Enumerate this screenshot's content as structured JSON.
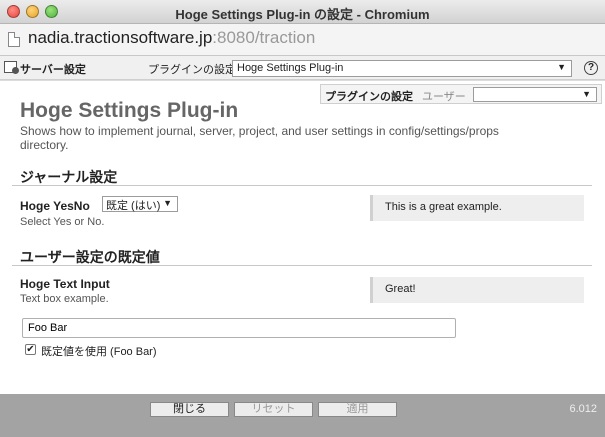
{
  "window": {
    "title": "Hoge Settings Plug-in の設定 - Chromium"
  },
  "address": {
    "host": "nadia.tractionsoftware.jp",
    "path": ":8080/traction"
  },
  "toolbar": {
    "server_label": "サーバー設定",
    "plugin_label": "プラグインの設定",
    "plugin_select_value": "Hoge Settings Plug-in",
    "help_icon": "?"
  },
  "tabs": {
    "plugin_tab": "プラグインの設定",
    "user_label": "ユーザー",
    "user_select_value": ""
  },
  "plugin": {
    "title": "Hoge Settings Plug-in",
    "description": "Shows how to implement journal, server, project, and user settings in config/settings/props directory."
  },
  "journal_section": {
    "heading": "ジャーナル設定",
    "field_label": "Hoge YesNo",
    "select_value": "既定 (はい)",
    "help": "Select Yes or No.",
    "note": "This is a great example."
  },
  "user_section": {
    "heading": "ユーザー設定の既定値",
    "field_label": "Hoge Text Input",
    "help": "Text box example.",
    "note": "Great!",
    "input_value": "Foo Bar",
    "checkbox_label": "既定値を使用 (Foo Bar)",
    "checkbox_checked": true
  },
  "footer": {
    "close_label": "閉じる",
    "reset_label": "リセット",
    "apply_label": "適用",
    "version": "6.012"
  }
}
